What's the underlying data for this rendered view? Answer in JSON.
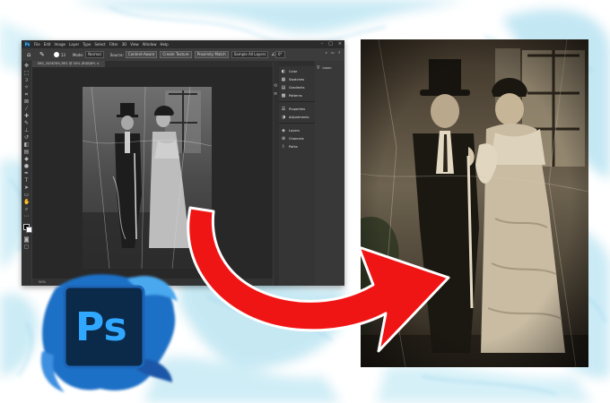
{
  "colors": {
    "background": "#ffffff",
    "watercolor": "#9fd8ec",
    "ps_panel": "#3a3a3a",
    "ps_blue": "#2fa8e0",
    "arrow": "#f01515"
  },
  "photoshop": {
    "logo_text": "Ps",
    "menu": [
      "File",
      "Edit",
      "Image",
      "Layer",
      "Type",
      "Select",
      "Filter",
      "3D",
      "View",
      "Window",
      "Help"
    ],
    "options": {
      "brush_size": "13",
      "mode_label": "Mode:",
      "mode_value": "Normal",
      "source_label": "Source:",
      "buttons": [
        "Content-Aware",
        "Create Texture",
        "Proximity Match"
      ],
      "sample_all": "Sample All Layers",
      "angle": "0°"
    },
    "doc_tab": "IMG_3456789_RES @ 50% (RGB/8*) ×",
    "zoom": "50%",
    "panels": [
      "Color",
      "Swatches",
      "Gradients",
      "Patterns",
      "Properties",
      "Adjustments",
      "Layers",
      "Channels",
      "Paths"
    ],
    "learn_label": "Learn"
  },
  "images": {
    "before": "old-couple-photo-damaged",
    "after": "old-couple-photo-restored"
  }
}
